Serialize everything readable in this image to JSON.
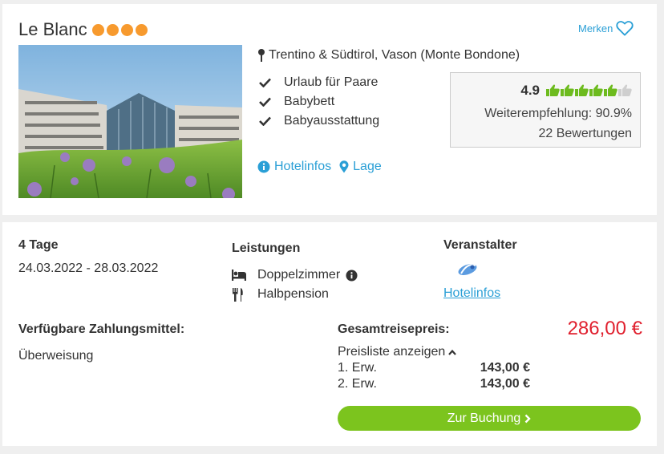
{
  "hotel": {
    "name": "Le Blanc",
    "rating_dots": 4,
    "save_label": "Merken",
    "location": "Trentino & Südtirol, Vason (Monte Bondone)",
    "features": [
      "Urlaub für Paare",
      "Babybett",
      "Babyausstattung"
    ],
    "links": {
      "info": "Hotelinfos",
      "location": "Lage"
    }
  },
  "review": {
    "score": "4.9",
    "thumbs_total": 6,
    "thumbs_filled": 5,
    "recommend": "Weiterempfehlung: 90.9%",
    "count": "22 Bewertungen"
  },
  "trip": {
    "duration": "4 Tage",
    "dates": "24.03.2022 - 28.03.2022",
    "services_title": "Leistungen",
    "room": "Doppelzimmer",
    "board": "Halbpension",
    "operator_title": "Veranstalter",
    "operator_link": "Hotelinfos"
  },
  "payment": {
    "title": "Verfügbare Zahlungsmittel:",
    "method": "Überweisung"
  },
  "pricing": {
    "total_label": "Gesamtreisepreis:",
    "total": "286,00 €",
    "list_toggle": "Preisliste anzeigen",
    "rows": [
      {
        "label": "1. Erw.",
        "value": "143,00 €"
      },
      {
        "label": "2. Erw.",
        "value": "143,00 €"
      }
    ],
    "book_label": "Zur Buchung"
  },
  "colors": {
    "accent": "#2a9fd6",
    "dots": "#f79a2e",
    "thumbs": "#6dbb1e",
    "price": "#e0202e",
    "button": "#7cc41e"
  }
}
